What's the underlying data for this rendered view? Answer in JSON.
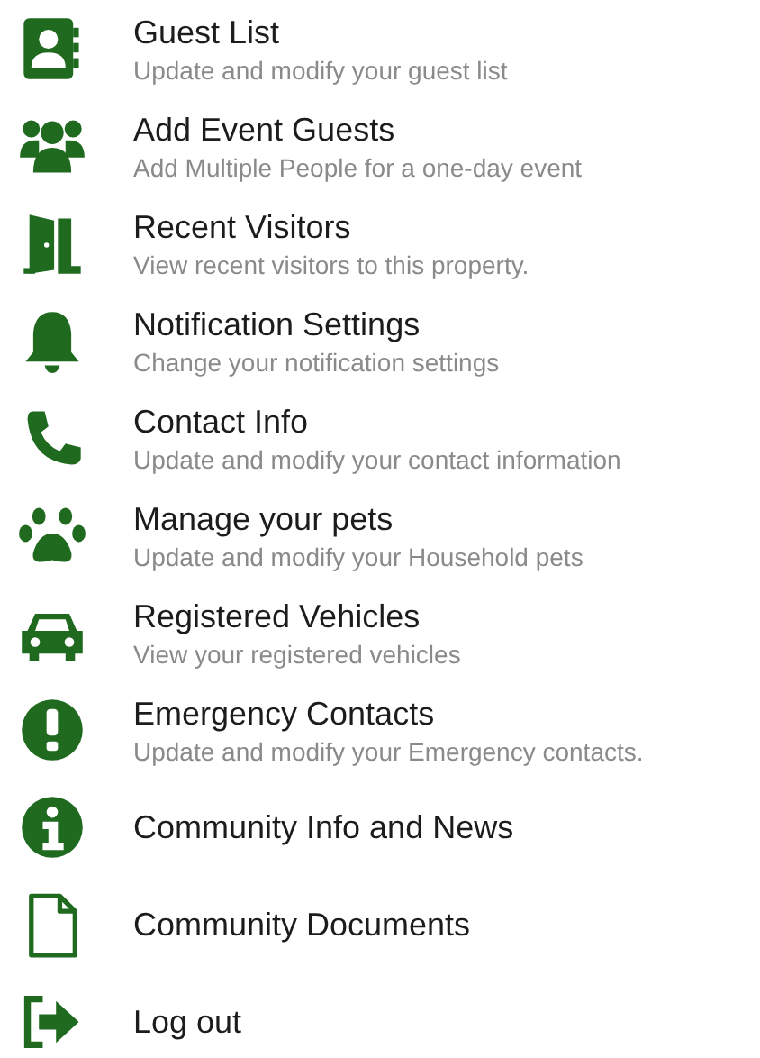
{
  "menu": [
    {
      "title": "Guest List",
      "subtitle": "Update and modify your guest list"
    },
    {
      "title": "Add Event Guests",
      "subtitle": "Add Multiple People for a one-day event"
    },
    {
      "title": "Recent Visitors",
      "subtitle": "View recent visitors to this property."
    },
    {
      "title": "Notification Settings",
      "subtitle": "Change your notification settings"
    },
    {
      "title": "Contact Info",
      "subtitle": "Update and modify your contact information"
    },
    {
      "title": "Manage your pets",
      "subtitle": "Update and modify your Household pets"
    },
    {
      "title": "Registered Vehicles",
      "subtitle": "View your registered vehicles"
    },
    {
      "title": "Emergency Contacts",
      "subtitle": "Update and modify your Emergency contacts."
    },
    {
      "title": "Community Info and News"
    },
    {
      "title": "Community Documents"
    },
    {
      "title": "Log out"
    }
  ]
}
